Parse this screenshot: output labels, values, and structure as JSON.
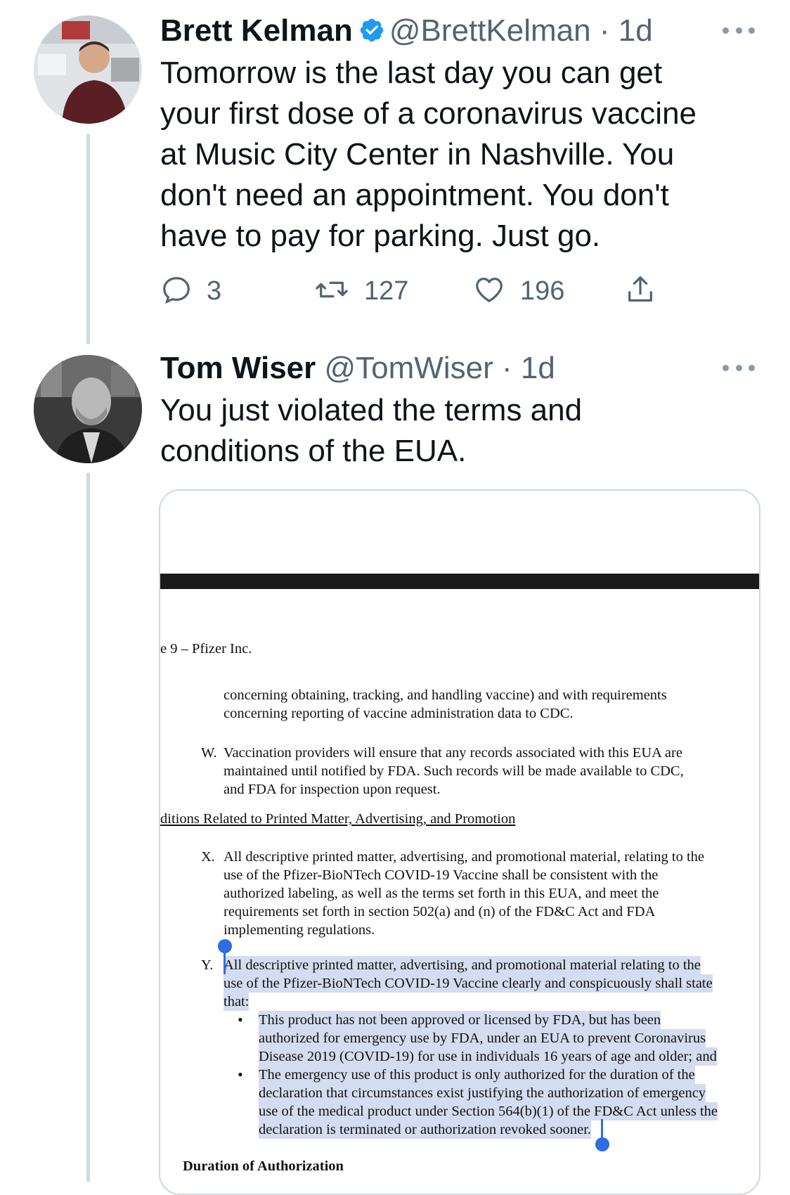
{
  "tweets": [
    {
      "name": "Brett Kelman",
      "handle": "@BrettKelman",
      "time": "· 1d",
      "verified": true,
      "text_lines": [
        "Tomorrow is the last day you can get",
        "your first dose of a coronavirus vaccine",
        "at Music City Center in Nashville. You",
        "don't need an appointment. You don't",
        "have to pay for parking. Just go."
      ],
      "actions": {
        "replies": "3",
        "retweets": "127",
        "likes": "196"
      }
    },
    {
      "name": "Tom Wiser",
      "handle": "@TomWiser",
      "time": "· 1d",
      "verified": false,
      "text_lines": [
        "You just violated the terms and",
        "conditions of the EUA."
      ]
    }
  ],
  "document": {
    "page_header": "e 9 – Pfizer Inc.",
    "v_cont": [
      "concerning obtaining, tracking, and handling vaccine) and with requirements",
      "concerning reporting of vaccine administration data to CDC."
    ],
    "w_label": "W.",
    "w_lines": [
      "Vaccination providers will ensure that any records associated with this EUA are",
      "maintained until notified by FDA.  Such records will be made available to CDC,",
      "and FDA for inspection upon request."
    ],
    "section_heading": "ditions Related to Printed Matter, Advertising, and Promotion",
    "x_label": "X.",
    "x_lines": [
      "All descriptive printed matter, advertising, and promotional material, relating to the",
      "use of the Pfizer-BioNTech COVID-19 Vaccine shall be consistent with the",
      "authorized labeling, as well as the terms set forth in this EUA, and meet the",
      "requirements set forth in section 502(a) and (n) of the FD&C Act and FDA",
      "implementing regulations."
    ],
    "y_label": "Y.",
    "y_lines": [
      "All descriptive printed matter, advertising, and promotional material relating to the",
      "use of the Pfizer-BioNTech COVID-19 Vaccine clearly and conspicuously shall state",
      "that:"
    ],
    "bullet_dot": "•",
    "bullet1_lines": [
      "This product has not been approved or licensed by FDA, but has been",
      "authorized for emergency use by FDA, under an EUA to prevent Coronavirus",
      "Disease 2019 (COVID-19) for use in individuals 16 years of age and older; and"
    ],
    "bullet2_lines": [
      "The emergency use of this product is only authorized for the duration of the",
      "declaration that circumstances exist justifying the authorization of emergency",
      "use of the medical product under Section 564(b)(1) of the FD&C Act unless the",
      "declaration is terminated or authorization revoked sooner."
    ],
    "duration_heading": "Duration of Authorization"
  },
  "colors": {
    "verified": "#1d9bf0",
    "highlight": "#d4dcf0",
    "selection_handle": "#2f6de0",
    "secondary_text": "#536471"
  },
  "icons": [
    "verified-badge-icon",
    "more-icon",
    "reply-icon",
    "retweet-icon",
    "like-icon",
    "share-icon"
  ]
}
